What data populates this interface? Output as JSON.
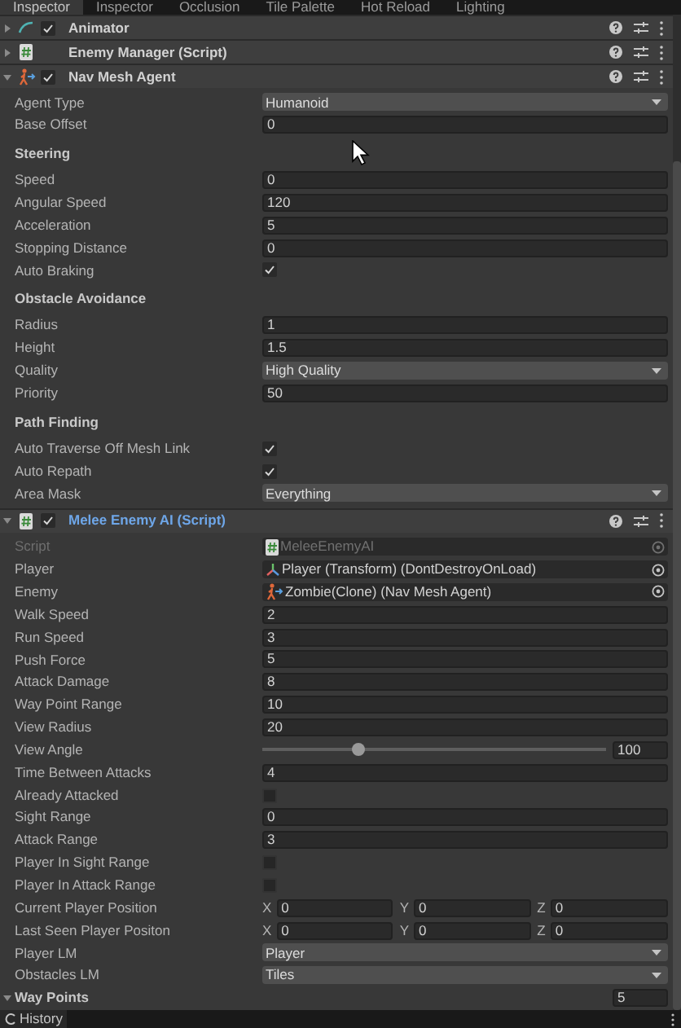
{
  "tabs": [
    {
      "label": "Inspector",
      "selected": true
    },
    {
      "label": "Inspector",
      "selected": false
    },
    {
      "label": "Occlusion",
      "selected": false
    },
    {
      "label": "Tile Palette",
      "selected": false
    },
    {
      "label": "Hot Reload",
      "selected": false
    },
    {
      "label": "Lighting",
      "selected": false
    }
  ],
  "components": [
    {
      "title": "Animator",
      "enabled": true,
      "expanded": false,
      "highlighted": false
    },
    {
      "title": "Enemy Manager (Script)",
      "expanded": false,
      "highlighted": false
    },
    {
      "title": "Nav Mesh Agent",
      "enabled": true,
      "expanded": true,
      "highlighted": false,
      "rows": [
        {
          "kind": "dropdown",
          "label": "Agent Type",
          "value": "Humanoid"
        },
        {
          "kind": "field",
          "label": "Base Offset",
          "value": "0"
        },
        {
          "kind": "heading",
          "label": "Steering"
        },
        {
          "kind": "field",
          "label": "Speed",
          "value": "0"
        },
        {
          "kind": "field",
          "label": "Angular Speed",
          "value": "120"
        },
        {
          "kind": "field",
          "label": "Acceleration",
          "value": "5"
        },
        {
          "kind": "field",
          "label": "Stopping Distance",
          "value": "0"
        },
        {
          "kind": "checkbox",
          "label": "Auto Braking",
          "checked": true
        },
        {
          "kind": "heading",
          "label": "Obstacle Avoidance"
        },
        {
          "kind": "field",
          "label": "Radius",
          "value": "1"
        },
        {
          "kind": "field",
          "label": "Height",
          "value": "1.5"
        },
        {
          "kind": "dropdown",
          "label": "Quality",
          "value": "High Quality"
        },
        {
          "kind": "field",
          "label": "Priority",
          "value": "50"
        },
        {
          "kind": "heading",
          "label": "Path Finding"
        },
        {
          "kind": "checkbox",
          "label": "Auto Traverse Off Mesh Link",
          "checked": true
        },
        {
          "kind": "checkbox",
          "label": "Auto Repath",
          "checked": true
        },
        {
          "kind": "dropdown",
          "label": "Area Mask",
          "value": "Everything"
        }
      ]
    },
    {
      "title": "Melee Enemy AI (Script)",
      "enabled": true,
      "expanded": true,
      "highlighted": true,
      "rows": [
        {
          "kind": "object",
          "label": "Script",
          "value": "MeleeEnemyAI",
          "disabled": true
        },
        {
          "kind": "object",
          "label": "Player",
          "value": "Player (Transform) (DontDestroyOnLoad)",
          "disabled": false
        },
        {
          "kind": "object",
          "label": "Enemy",
          "value": "Zombie(Clone) (Nav Mesh Agent)",
          "disabled": false
        },
        {
          "kind": "field",
          "label": "Walk Speed",
          "value": "2"
        },
        {
          "kind": "field",
          "label": "Run Speed",
          "value": "3"
        },
        {
          "kind": "field",
          "label": "Push Force",
          "value": "5"
        },
        {
          "kind": "field",
          "label": "Attack Damage",
          "value": "8"
        },
        {
          "kind": "field",
          "label": "Way Point Range",
          "value": "10"
        },
        {
          "kind": "field",
          "label": "View Radius",
          "value": "20"
        },
        {
          "kind": "slider",
          "label": "View Angle",
          "value": "100",
          "level": 0.28
        },
        {
          "kind": "field",
          "label": "Time Between Attacks",
          "value": "4"
        },
        {
          "kind": "checkbox",
          "label": "Already Attacked",
          "checked": false
        },
        {
          "kind": "field",
          "label": "Sight Range",
          "value": "0"
        },
        {
          "kind": "field",
          "label": "Attack Range",
          "value": "3"
        },
        {
          "kind": "checkbox",
          "label": "Player In Sight Range",
          "checked": false
        },
        {
          "kind": "checkbox",
          "label": "Player In Attack Range",
          "checked": false
        },
        {
          "kind": "vector3",
          "label": "Current Player Position",
          "axes": [
            {
              "axis": "X",
              "value": "0"
            },
            {
              "axis": "Y",
              "value": "0"
            },
            {
              "axis": "Z",
              "value": "0"
            }
          ]
        },
        {
          "kind": "vector3",
          "label": "Last Seen Player Positon",
          "axes": [
            {
              "axis": "X",
              "value": "0"
            },
            {
              "axis": "Y",
              "value": "0"
            },
            {
              "axis": "Z",
              "value": "0"
            }
          ]
        },
        {
          "kind": "dropdown",
          "label": "Player LM",
          "value": "Player"
        },
        {
          "kind": "dropdown",
          "label": "Obstacles LM",
          "value": "Tiles"
        },
        {
          "kind": "foldout",
          "label": "Way Points",
          "value": "5",
          "expanded": true
        }
      ]
    }
  ],
  "bottom_tab": {
    "label": "History"
  }
}
